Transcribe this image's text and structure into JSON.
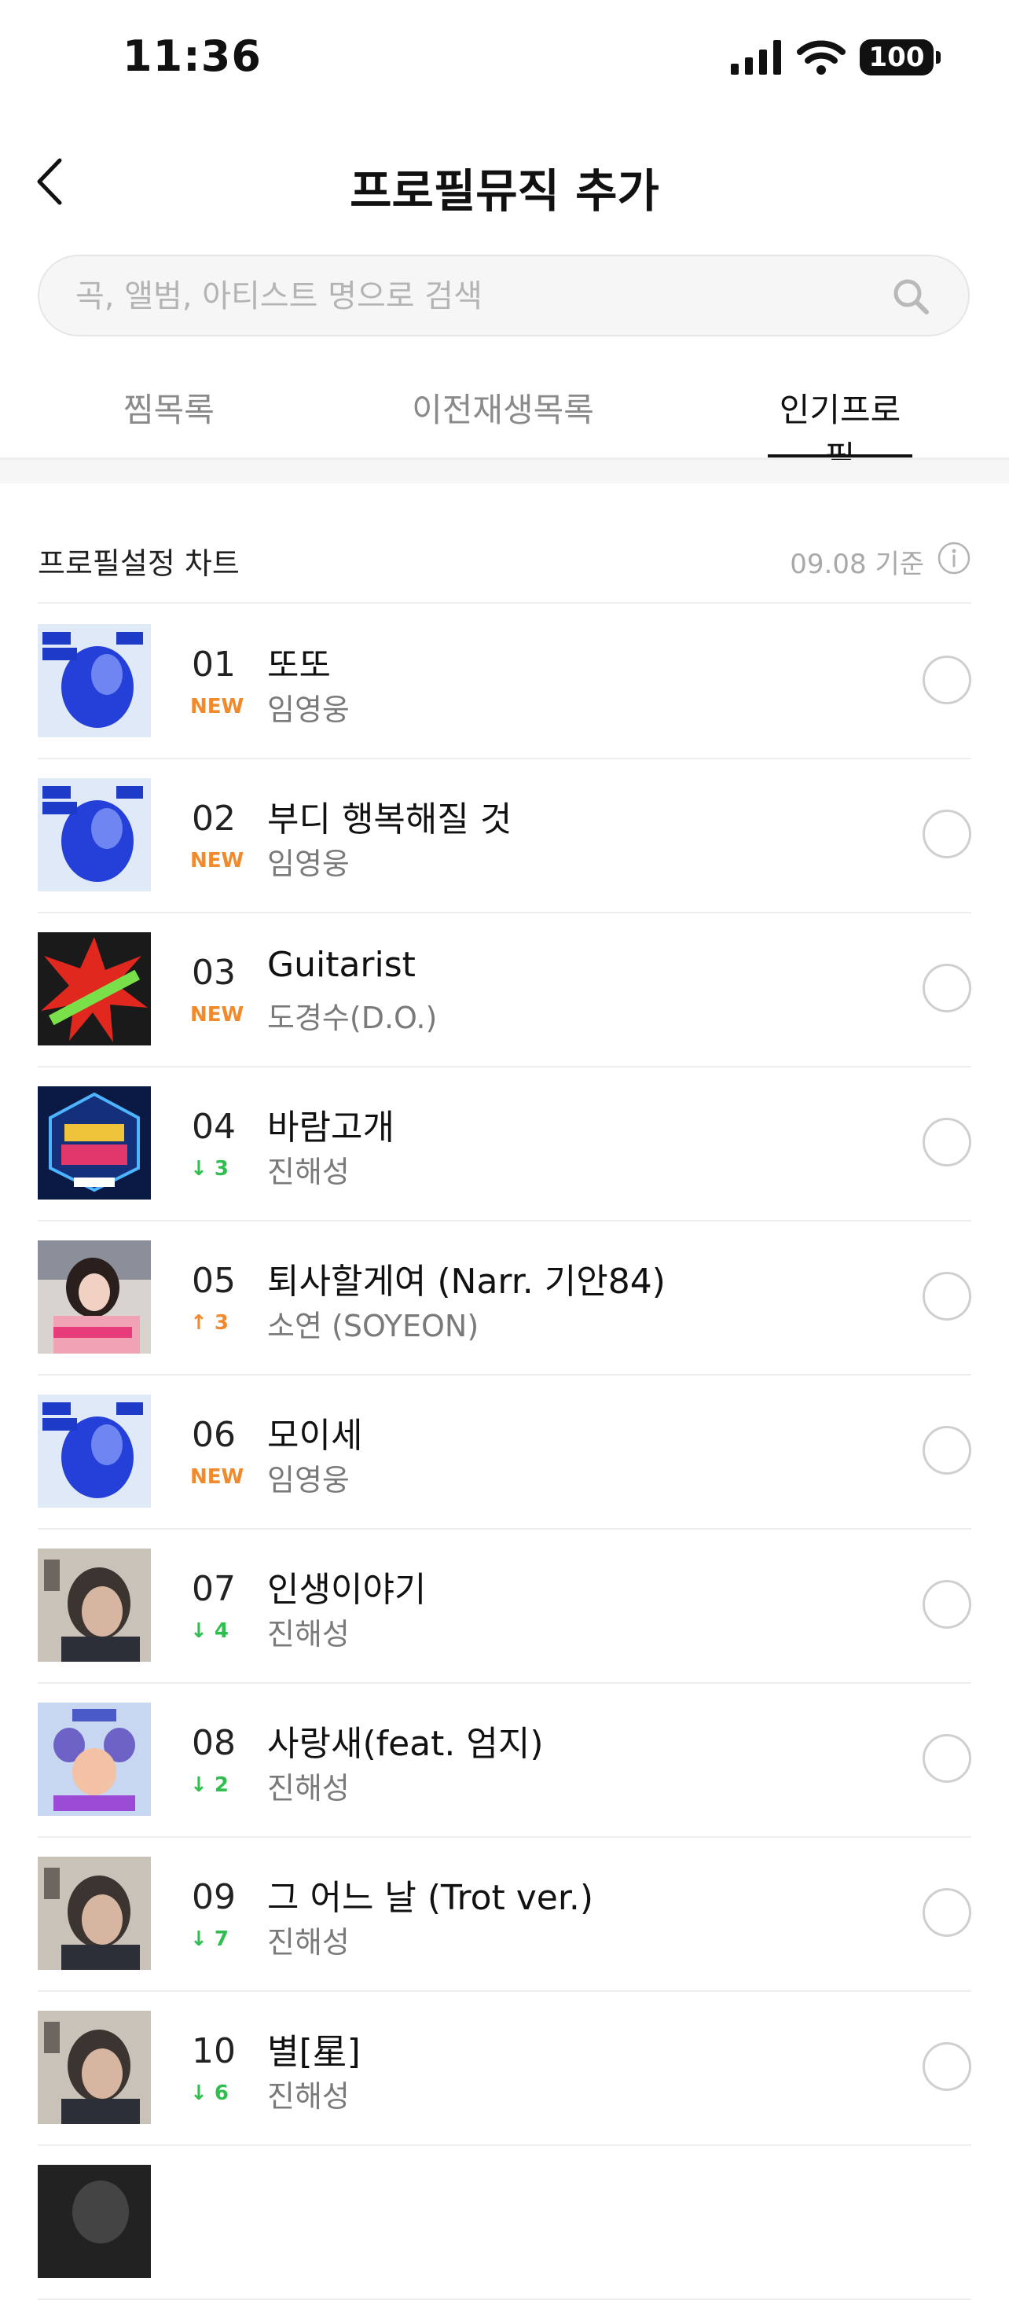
{
  "status": {
    "time": "11:36",
    "battery": "100"
  },
  "nav": {
    "title": "프로필뮤직 추가"
  },
  "search": {
    "placeholder": "곡, 앨범, 아티스트 명으로 검색",
    "value": ""
  },
  "tabs": [
    {
      "label": "찜목록"
    },
    {
      "label": "이전재생목록"
    },
    {
      "label": "인기프로필",
      "active": true
    }
  ],
  "chart": {
    "title": "프로필설정 차트",
    "date": "09.08 기준"
  },
  "songs": [
    {
      "rank": "01",
      "change": "NEW",
      "title": "또또",
      "artist": "임영웅"
    },
    {
      "rank": "02",
      "change": "NEW",
      "title": "부디 행복해질 것",
      "artist": "임영웅"
    },
    {
      "rank": "03",
      "change": "NEW",
      "title": "Guitarist",
      "artist": "도경수(D.O.)"
    },
    {
      "rank": "04",
      "change": "↓ 3",
      "title": "바람고개",
      "artist": "진해성"
    },
    {
      "rank": "05",
      "change": "↑ 3",
      "title": "퇴사할게여 (Narr. 기안84)",
      "artist": "소연 (SOYEON)"
    },
    {
      "rank": "06",
      "change": "NEW",
      "title": "모이세",
      "artist": "임영웅"
    },
    {
      "rank": "07",
      "change": "↓ 4",
      "title": "인생이야기",
      "artist": "진해성"
    },
    {
      "rank": "08",
      "change": "↓ 2",
      "title": "사랑새(feat. 엄지)",
      "artist": "진해성"
    },
    {
      "rank": "09",
      "change": "↓ 7",
      "title": "그 어느 날 (Trot ver.)",
      "artist": "진해성"
    },
    {
      "rank": "10",
      "change": "↓ 6",
      "title": "별[星]",
      "artist": "진해성"
    }
  ],
  "colors": {
    "new": "#f08a2c",
    "down": "#2fbf4f",
    "up": "#f08a2c"
  }
}
